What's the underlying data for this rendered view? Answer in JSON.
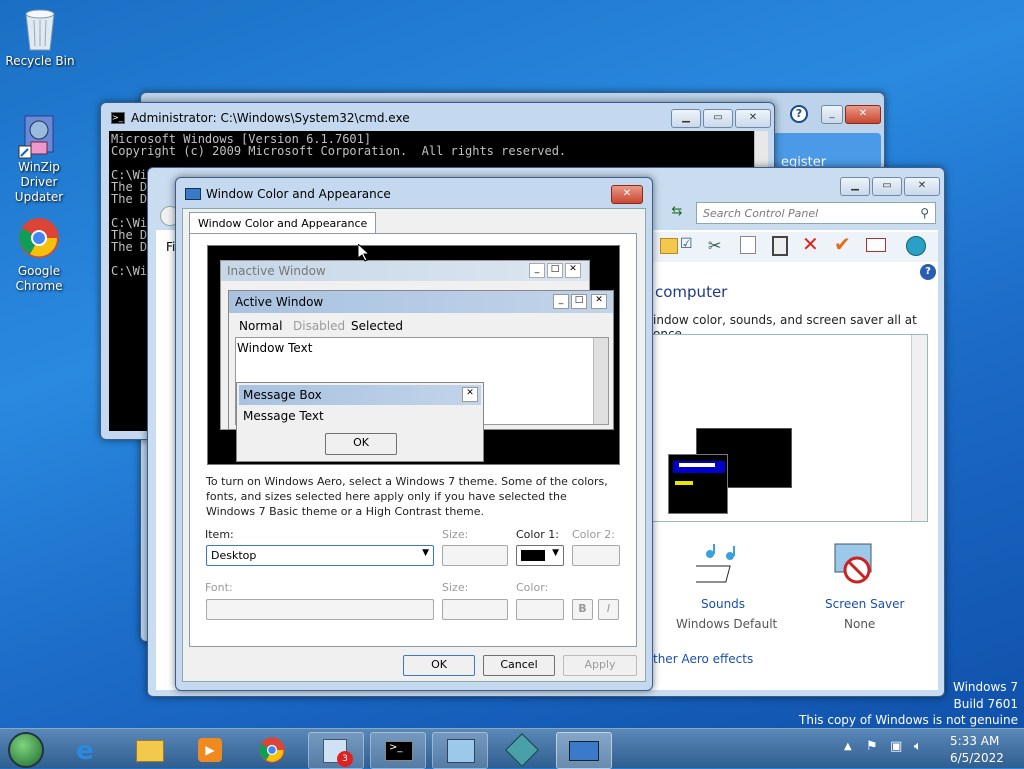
{
  "desktop": {
    "icons": [
      {
        "label": "Recycle Bin"
      },
      {
        "label": "WinZip Driver\nUpdater"
      },
      {
        "label": "Google\nChrome"
      }
    ],
    "watermark": [
      "Windows 7",
      "Build 7601",
      "This copy of Windows is not genuine"
    ]
  },
  "register_window": {
    "partial_text": "egister"
  },
  "cmd": {
    "title": "Administrator: C:\\Windows\\System32\\cmd.exe",
    "lines": "Microsoft Windows [Version 6.1.7601]\nCopyright (c) 2009 Microsoft Corporation.  All rights reserved.\n\nC:\\Wi\nThe D\nThe D\n\nC:\\Wi\nThe D\nThe D\n\nC:\\Wi"
  },
  "control_panel": {
    "search_placeholder": "Search Control Panel",
    "heading": "computer",
    "subtext": "indow color, sounds, and screen saver all at once.",
    "left_label": "Fi",
    "sounds_label": "Sounds",
    "sounds_value": "Windows Default",
    "saver_label": "Screen Saver",
    "saver_value": "None",
    "aero_link": "ther Aero effects"
  },
  "dialog": {
    "title": "Window Color and Appearance",
    "tab": "Window Color and Appearance",
    "preview": {
      "inactive": "Inactive Window",
      "active": "Active Window",
      "menu_normal": "Normal",
      "menu_disabled": "Disabled",
      "menu_selected": "Selected",
      "window_text": "Window Text",
      "msgbox_title": "Message Box",
      "msgbox_text": "Message Text",
      "ok": "OK"
    },
    "info": "To turn on Windows Aero, select a Windows 7 theme.  Some of the colors, fonts, and sizes selected here apply only if you have selected the Windows 7 Basic theme or a High Contrast theme.",
    "item_label": "Item:",
    "item_value": "Desktop",
    "size_label": "Size:",
    "color1_label": "Color 1:",
    "color2_label": "Color 2:",
    "font_label": "Font:",
    "size2_label": "Size:",
    "color_label": "Color:",
    "bold": "B",
    "italic": "I",
    "ok": "OK",
    "cancel": "Cancel",
    "apply": "Apply"
  },
  "taskbar": {
    "time": "5:33 AM",
    "date": "6/5/2022",
    "badge": "3"
  }
}
